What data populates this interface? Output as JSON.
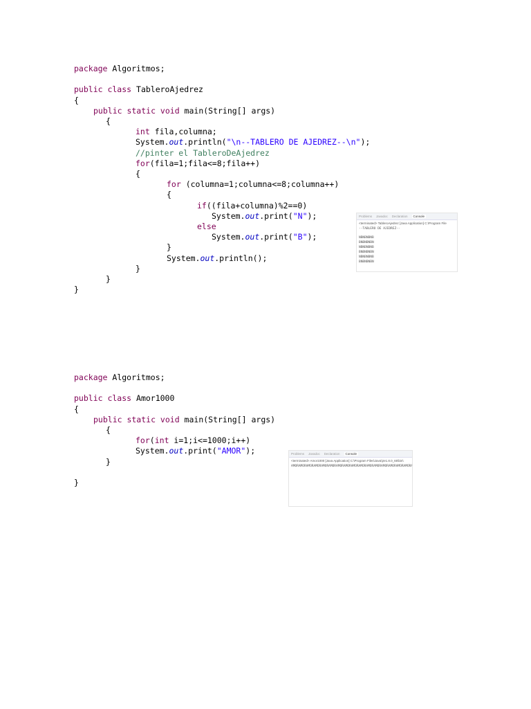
{
  "program1": {
    "lines": [
      {
        "indent": 0,
        "segs": [
          [
            "kw",
            "package"
          ],
          [
            "p",
            " Algoritmos;"
          ]
        ]
      },
      {
        "indent": 0,
        "segs": []
      },
      {
        "indent": 0,
        "segs": [
          [
            "kw",
            "public class"
          ],
          [
            "p",
            " TableroAjedrez"
          ]
        ]
      },
      {
        "indent": 0,
        "segs": [
          [
            "p",
            "{"
          ]
        ]
      },
      {
        "indent": 1,
        "segs": [
          [
            "kw",
            "public static void"
          ],
          [
            "p",
            " main(String[] args)"
          ]
        ]
      },
      {
        "indent": 2,
        "segs": [
          [
            "p",
            "{"
          ]
        ]
      },
      {
        "indent": 3,
        "segs": [
          [
            "kw",
            "int"
          ],
          [
            "p",
            " fila,columna;"
          ]
        ]
      },
      {
        "indent": 3,
        "segs": [
          [
            "p",
            "System."
          ],
          [
            "it",
            "out"
          ],
          [
            "p",
            ".println("
          ],
          [
            "str",
            "\"\\n--TABLERO DE AJEDREZ--\\n\""
          ],
          [
            "p",
            ");"
          ]
        ]
      },
      {
        "indent": 3,
        "segs": [
          [
            "cm",
            "//pinter el TableroDeAjedrez"
          ]
        ]
      },
      {
        "indent": 3,
        "segs": [
          [
            "kw",
            "for"
          ],
          [
            "p",
            "(fila=1;fila<=8;fila++)"
          ]
        ]
      },
      {
        "indent": 3,
        "segs": [
          [
            "p",
            "{"
          ]
        ]
      },
      {
        "indent": 4,
        "segs": [
          [
            "kw",
            "for"
          ],
          [
            "p",
            " (columna=1;columna<=8;columna++)"
          ]
        ]
      },
      {
        "indent": 4,
        "segs": [
          [
            "p",
            "{"
          ]
        ]
      },
      {
        "indent": 5,
        "segs": [
          [
            "kw",
            "if"
          ],
          [
            "p",
            "((fila+columna)%2==0)"
          ]
        ]
      },
      {
        "indent": 6,
        "segs": [
          [
            "p",
            "System."
          ],
          [
            "it",
            "out"
          ],
          [
            "p",
            ".print("
          ],
          [
            "str",
            "\"N\""
          ],
          [
            "p",
            ");"
          ]
        ]
      },
      {
        "indent": 5,
        "segs": [
          [
            "kw",
            "else"
          ]
        ]
      },
      {
        "indent": 6,
        "segs": [
          [
            "p",
            "System."
          ],
          [
            "it",
            "out"
          ],
          [
            "p",
            ".print("
          ],
          [
            "str",
            "\"B\""
          ],
          [
            "p",
            ");"
          ]
        ]
      },
      {
        "indent": 4,
        "segs": [
          [
            "p",
            "}"
          ]
        ]
      },
      {
        "indent": 4,
        "segs": [
          [
            "p",
            "System."
          ],
          [
            "it",
            "out"
          ],
          [
            "p",
            ".println();"
          ]
        ]
      },
      {
        "indent": 3,
        "segs": [
          [
            "p",
            "}"
          ]
        ]
      },
      {
        "indent": 2,
        "segs": [
          [
            "p",
            "}"
          ]
        ]
      },
      {
        "indent": 0,
        "segs": [
          [
            "p",
            "}"
          ]
        ]
      }
    ],
    "console": {
      "tabs": [
        "Problems",
        "Javadoc",
        "Declaration",
        "Console"
      ],
      "header": "<terminated> TableroAjedrez [Java Application] C:\\Program File",
      "output": [
        "--TABLERO DE AJEDREZ--",
        "",
        "NBNBNBNB",
        "BNBNBNBN",
        "NBNBNBNB",
        "BNBNBNBN",
        "NBNBNBNB",
        "BNBNBNBN"
      ]
    }
  },
  "program2": {
    "lines": [
      {
        "indent": 0,
        "segs": [
          [
            "kw",
            "package"
          ],
          [
            "p",
            " Algoritmos;"
          ]
        ]
      },
      {
        "indent": 0,
        "segs": []
      },
      {
        "indent": 0,
        "segs": [
          [
            "kw",
            "public class"
          ],
          [
            "p",
            " Amor1000"
          ]
        ]
      },
      {
        "indent": 0,
        "segs": [
          [
            "p",
            "{"
          ]
        ]
      },
      {
        "indent": 1,
        "segs": [
          [
            "kw",
            "public static void"
          ],
          [
            "p",
            " main(String[] args)"
          ]
        ]
      },
      {
        "indent": 2,
        "segs": [
          [
            "p",
            "{"
          ]
        ]
      },
      {
        "indent": 3,
        "segs": [
          [
            "kw",
            "for"
          ],
          [
            "p",
            "("
          ],
          [
            "kw",
            "int"
          ],
          [
            "p",
            " i=1;i<=1000;i++)"
          ]
        ]
      },
      {
        "indent": 3,
        "segs": [
          [
            "p",
            "System."
          ],
          [
            "it",
            "out"
          ],
          [
            "p",
            ".print("
          ],
          [
            "str",
            "\"AMOR\""
          ],
          [
            "p",
            ");"
          ]
        ]
      },
      {
        "indent": 2,
        "segs": [
          [
            "p",
            "}"
          ]
        ]
      },
      {
        "indent": 0,
        "segs": []
      },
      {
        "indent": 0,
        "segs": [
          [
            "p",
            "}"
          ]
        ]
      }
    ],
    "console": {
      "tabs": [
        "Problems",
        "Javadoc",
        "Declaration",
        "Console"
      ],
      "header": "<terminated> Amor1000 [Java Application] C:\\Program Files\\Java\\jre1.8.0_65\\bin\\",
      "output": [
        "AMORAMORAMORAMORAMORAMORAMORAMORAMORAMORAMORAMORAMORAMORAMORAMORAMORAMORAMOR"
      ]
    }
  }
}
